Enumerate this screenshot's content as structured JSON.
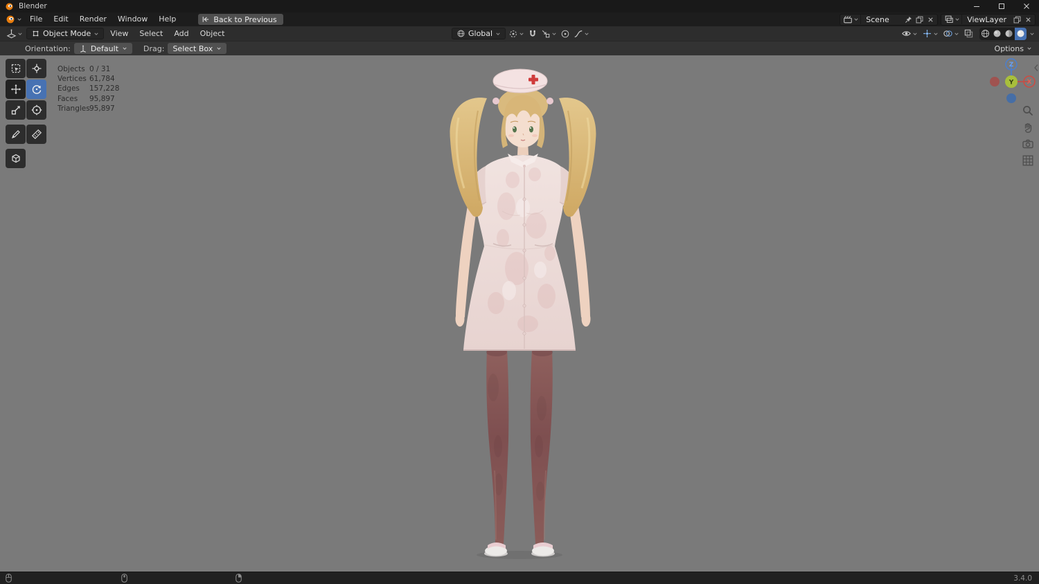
{
  "window": {
    "title": "Blender"
  },
  "menubar": {
    "menus": [
      "File",
      "Edit",
      "Render",
      "Window",
      "Help"
    ],
    "back_button": "Back to Previous",
    "scene": {
      "value": "Scene"
    },
    "view_layer": {
      "value": "ViewLayer"
    }
  },
  "viewport_header": {
    "mode": "Object Mode",
    "menus": [
      "View",
      "Select",
      "Add",
      "Object"
    ],
    "orientation": "Global"
  },
  "tool_settings": {
    "orientation_label": "Orientation:",
    "orientation_value": "Default",
    "drag_label": "Drag:",
    "drag_value": "Select Box",
    "options_label": "Options"
  },
  "stats": {
    "rows": [
      {
        "label": "Objects",
        "value": "0 / 31"
      },
      {
        "label": "Vertices",
        "value": "61,784"
      },
      {
        "label": "Edges",
        "value": "157,228"
      },
      {
        "label": "Faces",
        "value": "95,897"
      },
      {
        "label": "Triangles",
        "value": "95,897"
      }
    ]
  },
  "gizmo": {
    "x": "X",
    "y": "Y",
    "z": "Z"
  },
  "statusbar": {
    "version": "3.4.0"
  },
  "colors": {
    "accent": "#4772b3",
    "viewport_bg": "#7a7a7a",
    "axis_x": "#d04a40",
    "axis_y": "#a8bf3c",
    "axis_z": "#4a7fd0"
  }
}
